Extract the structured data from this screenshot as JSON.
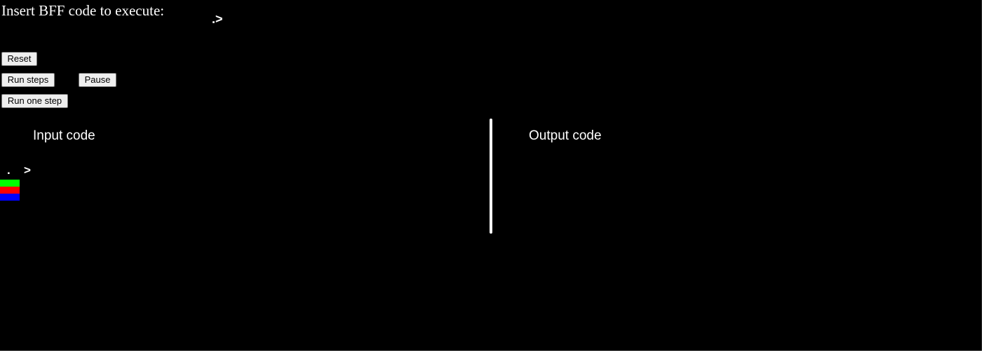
{
  "header": {
    "title": "Insert BFF code to execute:",
    "code_value": ".>"
  },
  "controls": {
    "reset_label": "Reset",
    "run_steps_label": "Run steps",
    "pause_label": "Pause",
    "run_one_step_label": "Run one step"
  },
  "panels": {
    "input_heading": "Input code",
    "output_heading": "Output code"
  },
  "tape": {
    "cells": [
      ".",
      ">"
    ]
  },
  "pointers": [
    {
      "name": "head0",
      "color": "#00ff00"
    },
    {
      "name": "head1",
      "color": "#ff0000"
    },
    {
      "name": "instruction",
      "color": "#0000ff"
    }
  ]
}
